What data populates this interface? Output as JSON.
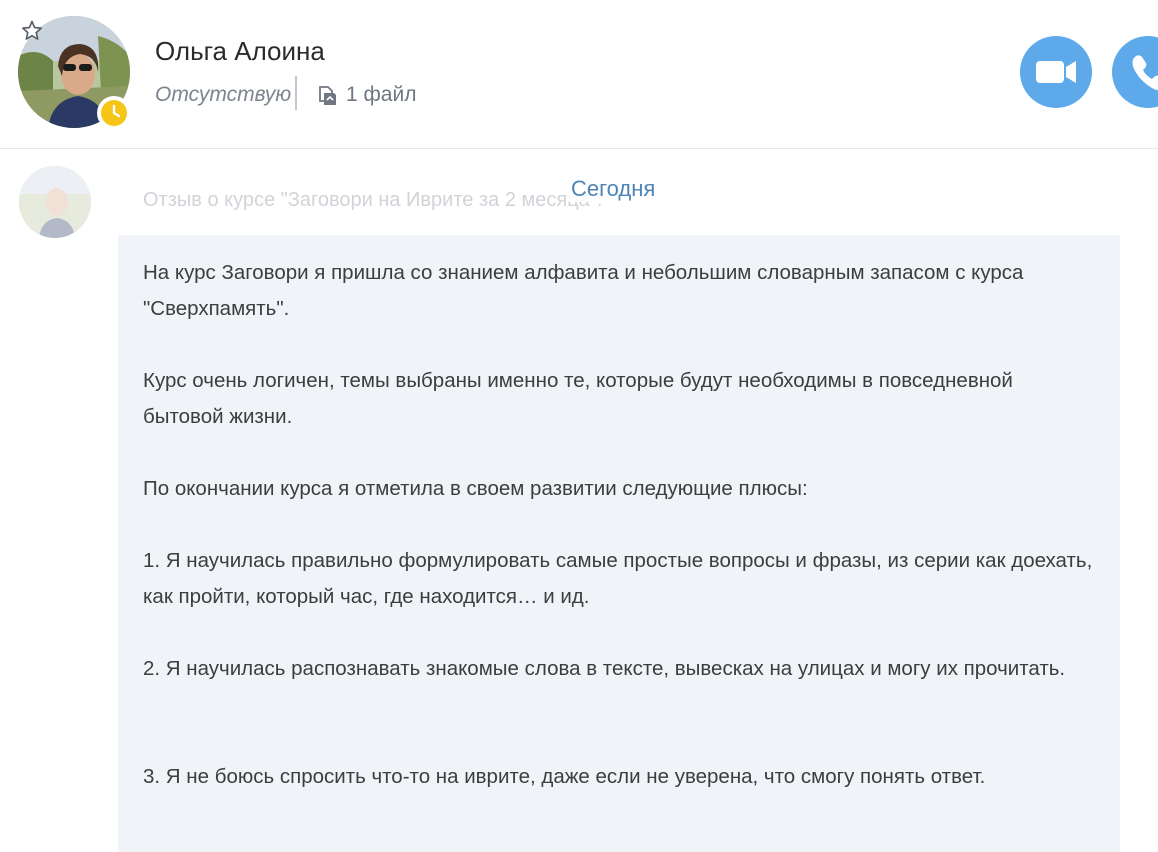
{
  "header": {
    "contact_name": "Ольга Алоина",
    "status": "Отсутствую",
    "files_label": "1 файл",
    "favorite_icon": "star-outline-icon",
    "status_badge_icon": "clock-icon",
    "video_call_icon": "video-camera-icon",
    "audio_call_icon": "phone-icon"
  },
  "feed": {
    "date_label": "Сегодня",
    "faded_subject": "Отзыв о курсе \"Заговори на Иврите за 2 месяца\".",
    "message": {
      "paragraphs": [
        "На курс Заговори я пришла со знанием алфавита и небольшим словарным запасом с курса \"Сверхпамять\".",
        "Курс очень логичен, темы выбраны именно те, которые будут необходимы в повседневной бытовой жизни.",
        "По окончании курса я отметила в своем развитии следующие плюсы:",
        "1. Я научилась правильно формулировать самые простые вопросы и фразы, из серии как доехать, как пройти, который час, где находится… и ид.",
        "2. Я научилась распознавать знакомые слова в тексте, вывесках на улицах и могу их прочитать.",
        "3. Я не боюсь спросить что-то на иврите, даже если не уверена, что смогу понять ответ."
      ]
    }
  },
  "colors": {
    "accent": "#5ea9e9",
    "date_label": "#4c84b5",
    "bubble_bg": "#f0f3f7",
    "status_badge": "#f5c518"
  }
}
